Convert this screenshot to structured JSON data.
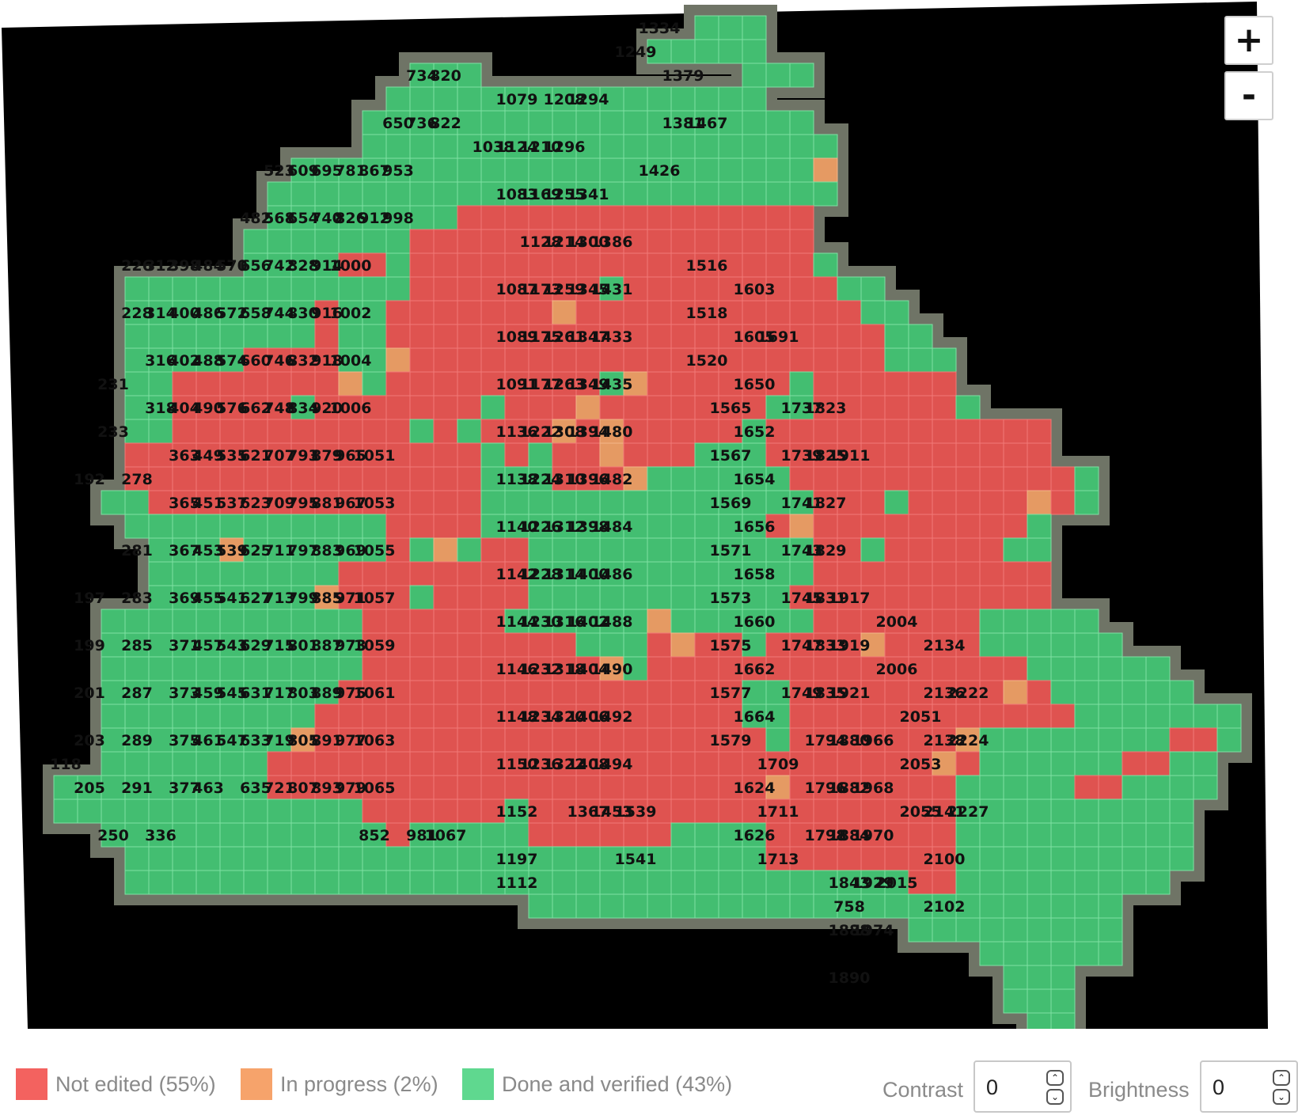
{
  "map": {
    "zoom_in_label": "+",
    "zoom_out_label": "-",
    "colors": {
      "not_edited": "#e8504e",
      "in_progress": "#ef9d63",
      "done": "#3fc472"
    },
    "labels": [
      [
        1334,
        27,
        1
      ],
      [
        1249,
        26,
        2
      ],
      [
        734,
        17,
        3
      ],
      [
        820,
        18,
        3
      ],
      [
        1379,
        28,
        3
      ],
      [
        1079,
        21,
        4
      ],
      [
        1208,
        23,
        4
      ],
      [
        1294,
        24,
        4
      ],
      [
        650,
        16,
        5
      ],
      [
        736,
        17,
        5
      ],
      [
        822,
        18,
        5
      ],
      [
        1381,
        28,
        5
      ],
      [
        1467,
        29,
        5
      ],
      [
        1038,
        20,
        6
      ],
      [
        1124,
        21,
        6
      ],
      [
        1210,
        22,
        6
      ],
      [
        1296,
        23,
        6
      ],
      [
        523,
        11,
        7
      ],
      [
        609,
        12,
        7
      ],
      [
        695,
        13,
        7
      ],
      [
        781,
        14,
        7
      ],
      [
        867,
        15,
        7
      ],
      [
        953,
        16,
        7
      ],
      [
        1426,
        27,
        7
      ],
      [
        1083,
        21,
        8
      ],
      [
        1169,
        22,
        8
      ],
      [
        1255,
        23,
        8
      ],
      [
        1341,
        24,
        8
      ],
      [
        482,
        10,
        9
      ],
      [
        568,
        11,
        9
      ],
      [
        654,
        12,
        9
      ],
      [
        740,
        13,
        9
      ],
      [
        826,
        14,
        9
      ],
      [
        912,
        15,
        9
      ],
      [
        998,
        16,
        9
      ],
      [
        1128,
        22,
        10
      ],
      [
        1214,
        23,
        10
      ],
      [
        1300,
        24,
        10
      ],
      [
        1386,
        25,
        10
      ],
      [
        226,
        5,
        11
      ],
      [
        312,
        6,
        11
      ],
      [
        398,
        7,
        11
      ],
      [
        484,
        8,
        11
      ],
      [
        570,
        9,
        11
      ],
      [
        656,
        10,
        11
      ],
      [
        742,
        11,
        11
      ],
      [
        828,
        12,
        11
      ],
      [
        914,
        13,
        11
      ],
      [
        1000,
        14,
        11
      ],
      [
        1516,
        29,
        11
      ],
      [
        1087,
        21,
        12
      ],
      [
        1173,
        22,
        12
      ],
      [
        1259,
        23,
        12
      ],
      [
        1345,
        24,
        12
      ],
      [
        1431,
        25,
        12
      ],
      [
        1603,
        31,
        12
      ],
      [
        228,
        5,
        13
      ],
      [
        314,
        6,
        13
      ],
      [
        400,
        7,
        13
      ],
      [
        486,
        8,
        13
      ],
      [
        572,
        9,
        13
      ],
      [
        658,
        10,
        13
      ],
      [
        744,
        11,
        13
      ],
      [
        830,
        12,
        13
      ],
      [
        916,
        13,
        13
      ],
      [
        1002,
        14,
        13
      ],
      [
        1518,
        29,
        13
      ],
      [
        1089,
        21,
        14
      ],
      [
        1175,
        22,
        14
      ],
      [
        1261,
        23,
        14
      ],
      [
        1347,
        24,
        14
      ],
      [
        1433,
        25,
        14
      ],
      [
        1605,
        31,
        14
      ],
      [
        1691,
        32,
        14
      ],
      [
        316,
        6,
        15
      ],
      [
        402,
        7,
        15
      ],
      [
        488,
        8,
        15
      ],
      [
        574,
        9,
        15
      ],
      [
        660,
        10,
        15
      ],
      [
        746,
        11,
        15
      ],
      [
        832,
        12,
        15
      ],
      [
        918,
        13,
        15
      ],
      [
        1004,
        14,
        15
      ],
      [
        1520,
        29,
        15
      ],
      [
        231,
        4,
        16
      ],
      [
        1091,
        21,
        16
      ],
      [
        1177,
        22,
        16
      ],
      [
        1263,
        23,
        16
      ],
      [
        1349,
        24,
        16
      ],
      [
        1435,
        25,
        16
      ],
      [
        1650,
        31,
        16
      ],
      [
        318,
        6,
        17
      ],
      [
        404,
        7,
        17
      ],
      [
        490,
        8,
        17
      ],
      [
        576,
        9,
        17
      ],
      [
        662,
        10,
        17
      ],
      [
        748,
        11,
        17
      ],
      [
        834,
        12,
        17
      ],
      [
        920,
        13,
        17
      ],
      [
        1006,
        14,
        17
      ],
      [
        1565,
        30,
        17
      ],
      [
        1737,
        33,
        17
      ],
      [
        1823,
        34,
        17
      ],
      [
        233,
        4,
        18
      ],
      [
        1136,
        21,
        18
      ],
      [
        1222,
        22,
        18
      ],
      [
        1308,
        23,
        18
      ],
      [
        1394,
        24,
        18
      ],
      [
        1480,
        25,
        18
      ],
      [
        1652,
        31,
        18
      ],
      [
        363,
        7,
        19
      ],
      [
        449,
        8,
        19
      ],
      [
        535,
        9,
        19
      ],
      [
        621,
        10,
        19
      ],
      [
        707,
        11,
        19
      ],
      [
        793,
        12,
        19
      ],
      [
        879,
        13,
        19
      ],
      [
        965,
        14,
        19
      ],
      [
        1051,
        15,
        19
      ],
      [
        1567,
        30,
        19
      ],
      [
        1739,
        33,
        19
      ],
      [
        1825,
        34,
        19
      ],
      [
        1911,
        35,
        19
      ],
      [
        192,
        3,
        20
      ],
      [
        278,
        5,
        20
      ],
      [
        1138,
        21,
        20
      ],
      [
        1224,
        22,
        20
      ],
      [
        1310,
        23,
        20
      ],
      [
        1396,
        24,
        20
      ],
      [
        1482,
        25,
        20
      ],
      [
        1654,
        31,
        20
      ],
      [
        365,
        7,
        21
      ],
      [
        451,
        8,
        21
      ],
      [
        537,
        9,
        21
      ],
      [
        623,
        10,
        21
      ],
      [
        709,
        11,
        21
      ],
      [
        795,
        12,
        21
      ],
      [
        881,
        13,
        21
      ],
      [
        967,
        14,
        21
      ],
      [
        1053,
        15,
        21
      ],
      [
        1569,
        30,
        21
      ],
      [
        1741,
        33,
        21
      ],
      [
        1827,
        34,
        21
      ],
      [
        1140,
        21,
        22
      ],
      [
        1226,
        22,
        22
      ],
      [
        1312,
        23,
        22
      ],
      [
        1398,
        24,
        22
      ],
      [
        1484,
        25,
        22
      ],
      [
        1656,
        31,
        22
      ],
      [
        281,
        5,
        23
      ],
      [
        367,
        7,
        23
      ],
      [
        453,
        8,
        23
      ],
      [
        539,
        9,
        23
      ],
      [
        625,
        10,
        23
      ],
      [
        711,
        11,
        23
      ],
      [
        797,
        12,
        23
      ],
      [
        883,
        13,
        23
      ],
      [
        969,
        14,
        23
      ],
      [
        1055,
        15,
        23
      ],
      [
        1571,
        30,
        23
      ],
      [
        1743,
        33,
        23
      ],
      [
        1829,
        34,
        23
      ],
      [
        1142,
        21,
        24
      ],
      [
        1228,
        22,
        24
      ],
      [
        1314,
        23,
        24
      ],
      [
        1400,
        24,
        24
      ],
      [
        1486,
        25,
        24
      ],
      [
        1658,
        31,
        24
      ],
      [
        197,
        3,
        25
      ],
      [
        283,
        5,
        25
      ],
      [
        369,
        7,
        25
      ],
      [
        455,
        8,
        25
      ],
      [
        541,
        9,
        25
      ],
      [
        627,
        10,
        25
      ],
      [
        713,
        11,
        25
      ],
      [
        799,
        12,
        25
      ],
      [
        885,
        13,
        25
      ],
      [
        971,
        14,
        25
      ],
      [
        1057,
        15,
        25
      ],
      [
        1573,
        30,
        25
      ],
      [
        1745,
        33,
        25
      ],
      [
        1831,
        34,
        25
      ],
      [
        1917,
        35,
        25
      ],
      [
        1144,
        21,
        26
      ],
      [
        1230,
        22,
        26
      ],
      [
        1316,
        23,
        26
      ],
      [
        1402,
        24,
        26
      ],
      [
        1488,
        25,
        26
      ],
      [
        1660,
        31,
        26
      ],
      [
        2004,
        37,
        26
      ],
      [
        199,
        3,
        27
      ],
      [
        285,
        5,
        27
      ],
      [
        371,
        7,
        27
      ],
      [
        457,
        8,
        27
      ],
      [
        543,
        9,
        27
      ],
      [
        629,
        10,
        27
      ],
      [
        715,
        11,
        27
      ],
      [
        801,
        12,
        27
      ],
      [
        887,
        13,
        27
      ],
      [
        973,
        14,
        27
      ],
      [
        1059,
        15,
        27
      ],
      [
        1575,
        30,
        27
      ],
      [
        1747,
        33,
        27
      ],
      [
        1833,
        34,
        27
      ],
      [
        1919,
        35,
        27
      ],
      [
        2134,
        39,
        27
      ],
      [
        1146,
        21,
        28
      ],
      [
        1232,
        22,
        28
      ],
      [
        1318,
        23,
        28
      ],
      [
        1404,
        24,
        28
      ],
      [
        1490,
        25,
        28
      ],
      [
        1662,
        31,
        28
      ],
      [
        2006,
        37,
        28
      ],
      [
        201,
        3,
        29
      ],
      [
        287,
        5,
        29
      ],
      [
        373,
        7,
        29
      ],
      [
        459,
        8,
        29
      ],
      [
        545,
        9,
        29
      ],
      [
        631,
        10,
        29
      ],
      [
        717,
        11,
        29
      ],
      [
        803,
        12,
        29
      ],
      [
        889,
        13,
        29
      ],
      [
        975,
        14,
        29
      ],
      [
        1061,
        15,
        29
      ],
      [
        1577,
        30,
        29
      ],
      [
        1749,
        33,
        29
      ],
      [
        1835,
        34,
        29
      ],
      [
        1921,
        35,
        29
      ],
      [
        2136,
        39,
        29
      ],
      [
        2222,
        40,
        29
      ],
      [
        1148,
        21,
        30
      ],
      [
        1234,
        22,
        30
      ],
      [
        1320,
        23,
        30
      ],
      [
        1406,
        24,
        30
      ],
      [
        1492,
        25,
        30
      ],
      [
        1664,
        31,
        30
      ],
      [
        2051,
        38,
        30
      ],
      [
        203,
        3,
        31
      ],
      [
        289,
        5,
        31
      ],
      [
        375,
        7,
        31
      ],
      [
        461,
        8,
        31
      ],
      [
        547,
        9,
        31
      ],
      [
        633,
        10,
        31
      ],
      [
        719,
        11,
        31
      ],
      [
        805,
        12,
        31
      ],
      [
        891,
        13,
        31
      ],
      [
        977,
        14,
        31
      ],
      [
        1063,
        15,
        31
      ],
      [
        1579,
        30,
        31
      ],
      [
        1794,
        34,
        31
      ],
      [
        1880,
        35,
        31
      ],
      [
        1966,
        36,
        31
      ],
      [
        2138,
        39,
        31
      ],
      [
        2224,
        40,
        31
      ],
      [
        118,
        2,
        32
      ],
      [
        1150,
        21,
        32
      ],
      [
        1236,
        22,
        32
      ],
      [
        1322,
        23,
        32
      ],
      [
        1408,
        24,
        32
      ],
      [
        1494,
        25,
        32
      ],
      [
        1709,
        32,
        32
      ],
      [
        2053,
        38,
        32
      ],
      [
        205,
        3,
        33
      ],
      [
        291,
        5,
        33
      ],
      [
        377,
        7,
        33
      ],
      [
        463,
        8,
        33
      ],
      [
        635,
        10,
        33
      ],
      [
        721,
        11,
        33
      ],
      [
        807,
        12,
        33
      ],
      [
        893,
        13,
        33
      ],
      [
        979,
        14,
        33
      ],
      [
        1065,
        15,
        33
      ],
      [
        1624,
        31,
        33
      ],
      [
        1796,
        34,
        33
      ],
      [
        1882,
        35,
        33
      ],
      [
        1968,
        36,
        33
      ],
      [
        1152,
        21,
        34
      ],
      [
        1367,
        24,
        34
      ],
      [
        1453,
        25,
        34
      ],
      [
        1539,
        26,
        34
      ],
      [
        1711,
        32,
        34
      ],
      [
        2055,
        38,
        34
      ],
      [
        2141,
        39,
        34
      ],
      [
        2227,
        40,
        34
      ],
      [
        250,
        4,
        35
      ],
      [
        336,
        6,
        35
      ],
      [
        852,
        15,
        35
      ],
      [
        981,
        17,
        35
      ],
      [
        1067,
        18,
        35
      ],
      [
        1626,
        31,
        35
      ],
      [
        1798,
        34,
        35
      ],
      [
        1884,
        35,
        35
      ],
      [
        1970,
        36,
        35
      ],
      [
        1197,
        21,
        36
      ],
      [
        1541,
        26,
        36
      ],
      [
        1713,
        32,
        36
      ],
      [
        2100,
        39,
        36
      ],
      [
        1112,
        21,
        37
      ],
      [
        1843,
        35,
        37
      ],
      [
        1929,
        36,
        37
      ],
      [
        2015,
        37,
        37
      ],
      [
        758,
        35,
        38
      ],
      [
        2102,
        39,
        38
      ],
      [
        1888,
        35,
        39
      ],
      [
        1974,
        36,
        39
      ],
      [
        1890,
        35,
        41
      ]
    ]
  },
  "legend": {
    "not_edited": "Not edited (55%)",
    "in_progress": "In progress (2%)",
    "done": "Done and verified (43%)"
  },
  "controls": {
    "contrast_label": "Contrast",
    "contrast_value": "0",
    "brightness_label": "Brightness",
    "brightness_value": "0"
  }
}
